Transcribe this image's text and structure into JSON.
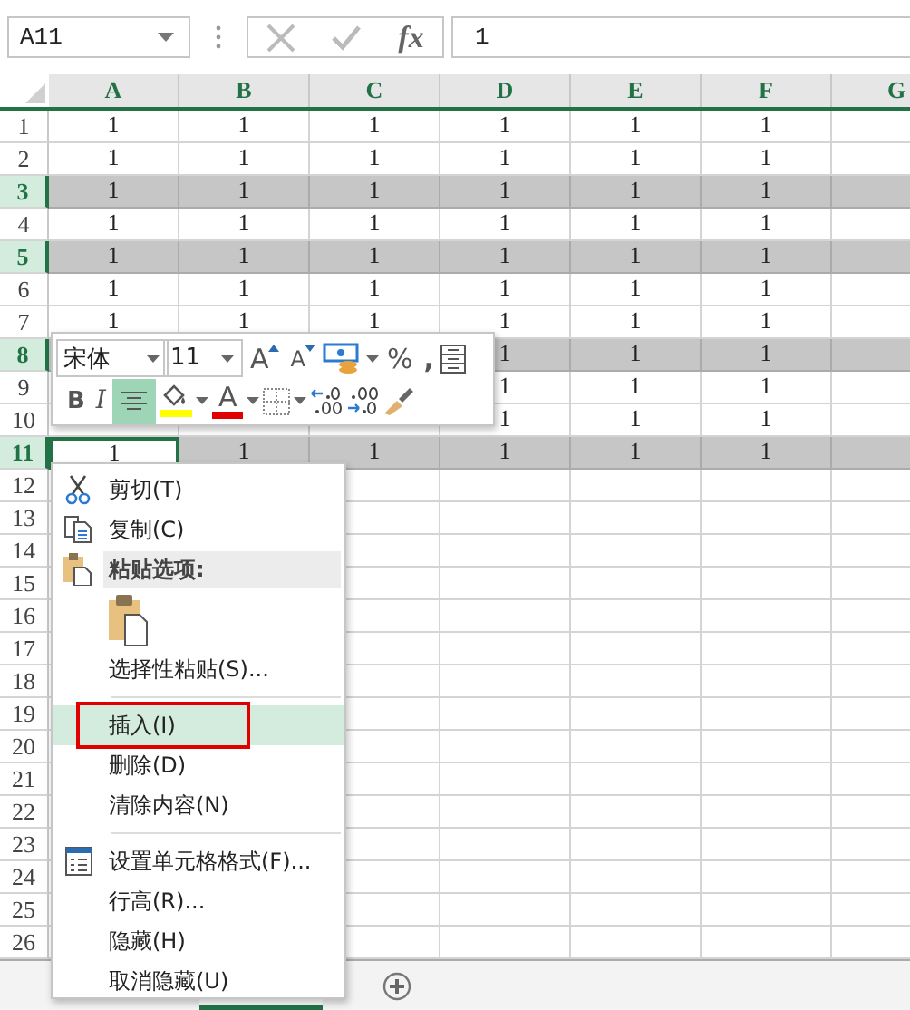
{
  "formula_bar": {
    "name_box": "A11",
    "function_label": "fx",
    "formula": "1"
  },
  "columns": [
    "A",
    "B",
    "C",
    "D",
    "E",
    "F",
    "G"
  ],
  "rows": [
    {
      "header": "1",
      "selected": false,
      "has_active_cell": false,
      "cells": [
        "1",
        "1",
        "1",
        "1",
        "1",
        "1"
      ]
    },
    {
      "header": "2",
      "selected": false,
      "has_active_cell": false,
      "cells": [
        "1",
        "1",
        "1",
        "1",
        "1",
        "1"
      ]
    },
    {
      "header": "3",
      "selected": true,
      "has_active_cell": false,
      "cells": [
        "1",
        "1",
        "1",
        "1",
        "1",
        "1"
      ]
    },
    {
      "header": "4",
      "selected": false,
      "has_active_cell": false,
      "cells": [
        "1",
        "1",
        "1",
        "1",
        "1",
        "1"
      ]
    },
    {
      "header": "5",
      "selected": true,
      "has_active_cell": false,
      "cells": [
        "1",
        "1",
        "1",
        "1",
        "1",
        "1"
      ]
    },
    {
      "header": "6",
      "selected": false,
      "has_active_cell": false,
      "cells": [
        "1",
        "1",
        "1",
        "1",
        "1",
        "1"
      ]
    },
    {
      "header": "7",
      "selected": false,
      "has_active_cell": false,
      "cells": [
        "1",
        "1",
        "1",
        "1",
        "1",
        "1"
      ]
    },
    {
      "header": "8",
      "selected": true,
      "has_active_cell": false,
      "cells": [
        "1",
        "1",
        "1"
      ]
    },
    {
      "header": "9",
      "selected": false,
      "has_active_cell": false,
      "cells": [
        "1",
        "1",
        "1"
      ]
    },
    {
      "header": "10",
      "selected": false,
      "has_active_cell": false,
      "cells": [
        "1",
        "1",
        "1"
      ]
    },
    {
      "header": "11",
      "selected": true,
      "has_active_cell": true,
      "cells": [
        "1",
        "1",
        "1",
        "1",
        "1",
        "1"
      ]
    },
    {
      "header": "12",
      "selected": false,
      "has_active_cell": false
    },
    {
      "header": "13",
      "selected": false,
      "has_active_cell": false
    },
    {
      "header": "14",
      "selected": false,
      "has_active_cell": false
    },
    {
      "header": "15",
      "selected": false,
      "has_active_cell": false
    },
    {
      "header": "16",
      "selected": false,
      "has_active_cell": false
    },
    {
      "header": "17",
      "selected": false,
      "has_active_cell": false
    },
    {
      "header": "18",
      "selected": false,
      "has_active_cell": false
    },
    {
      "header": "19",
      "selected": false,
      "has_active_cell": false
    },
    {
      "header": "20",
      "selected": false,
      "has_active_cell": false
    },
    {
      "header": "21",
      "selected": false,
      "has_active_cell": false
    },
    {
      "header": "22",
      "selected": false,
      "has_active_cell": false
    },
    {
      "header": "23",
      "selected": false,
      "has_active_cell": false
    },
    {
      "header": "24",
      "selected": false,
      "has_active_cell": false
    },
    {
      "header": "25",
      "selected": false,
      "has_active_cell": false
    },
    {
      "header": "26",
      "selected": false,
      "has_active_cell": false
    }
  ],
  "mini_toolbar": {
    "font": "宋体",
    "size": "11",
    "grow_letter": "A",
    "shrink_letter": "A",
    "percent": "%",
    "comma": ",",
    "bold": "B",
    "italic": "I",
    "align_center_selected": true,
    "font_color_letter": "A"
  },
  "context_menu": {
    "items": [
      {
        "kind": "cut",
        "label": "剪切(T)",
        "selected": false,
        "outlined": false
      },
      {
        "kind": "copy",
        "label": "复制(C)",
        "selected": false,
        "outlined": false
      },
      {
        "kind": "paste-header",
        "label": "粘贴选项:"
      },
      {
        "kind": "paste-options"
      },
      {
        "kind": "plain",
        "label": "选择性粘贴(S)...",
        "selected": false,
        "outlined": false
      },
      {
        "kind": "separator"
      },
      {
        "kind": "plain",
        "label": "插入(I)",
        "selected": true,
        "outlined": true
      },
      {
        "kind": "plain",
        "label": "删除(D)",
        "selected": false,
        "outlined": false
      },
      {
        "kind": "plain",
        "label": "清除内容(N)",
        "selected": false,
        "outlined": false
      },
      {
        "kind": "separator"
      },
      {
        "kind": "format",
        "label": "设置单元格格式(F)...",
        "selected": false,
        "outlined": false
      },
      {
        "kind": "plain",
        "label": "行高(R)...",
        "selected": false,
        "outlined": false
      },
      {
        "kind": "plain",
        "label": "隐藏(H)",
        "selected": false,
        "outlined": false
      },
      {
        "kind": "plain",
        "label": "取消隐藏(U)",
        "selected": false,
        "outlined": false
      }
    ]
  }
}
